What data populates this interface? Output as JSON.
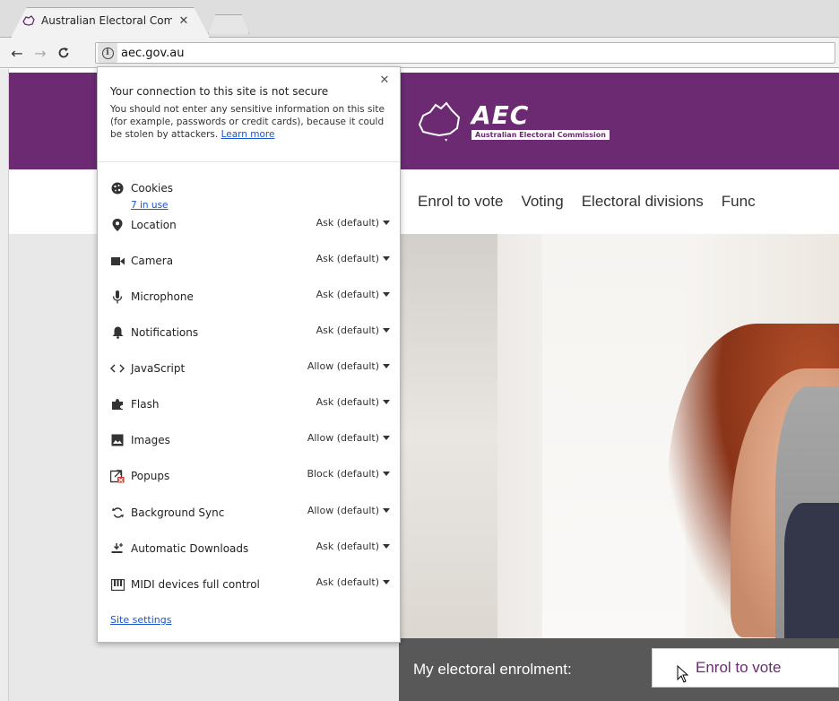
{
  "browser": {
    "tab_title": "Australian Electoral Comm",
    "url": "aec.gov.au"
  },
  "site": {
    "logo_text": "AEC",
    "logo_subtitle": "Australian Electoral Commission",
    "nav_items": [
      {
        "label": "Enrol to vote"
      },
      {
        "label": "Voting"
      },
      {
        "label": "Electoral divisions"
      },
      {
        "label": "Func"
      }
    ],
    "enrolment_label": "My electoral enrolment:",
    "enrolment_button": "Enrol to vote"
  },
  "popup": {
    "title": "Your connection to this site is not secure",
    "body": "You should not enter any sensitive information on this site (for example, passwords or credit cards), because it could be stolen by attackers.",
    "learn_more": "Learn more",
    "cookies_label": "Cookies",
    "cookies_in_use": "7 in use",
    "permissions": [
      {
        "label": "Location",
        "value": "Ask (default)",
        "icon": "location-pin-icon"
      },
      {
        "label": "Camera",
        "value": "Ask (default)",
        "icon": "camera-icon"
      },
      {
        "label": "Microphone",
        "value": "Ask (default)",
        "icon": "microphone-icon"
      },
      {
        "label": "Notifications",
        "value": "Ask (default)",
        "icon": "bell-icon"
      },
      {
        "label": "JavaScript",
        "value": "Allow (default)",
        "icon": "code-icon"
      },
      {
        "label": "Flash",
        "value": "Ask (default)",
        "icon": "puzzle-icon"
      },
      {
        "label": "Images",
        "value": "Allow (default)",
        "icon": "image-icon"
      },
      {
        "label": "Popups",
        "value": "Block (default)",
        "icon": "popup-blocked-icon"
      },
      {
        "label": "Background Sync",
        "value": "Allow (default)",
        "icon": "sync-icon"
      },
      {
        "label": "Automatic Downloads",
        "value": "Ask (default)",
        "icon": "download-icon"
      },
      {
        "label": "MIDI devices full control",
        "value": "Ask (default)",
        "icon": "midi-icon"
      }
    ],
    "site_settings": "Site settings"
  },
  "colors": {
    "brand_purple": "#6b2a72",
    "link_blue": "#1a55c9",
    "enrol_bar": "#585858"
  }
}
